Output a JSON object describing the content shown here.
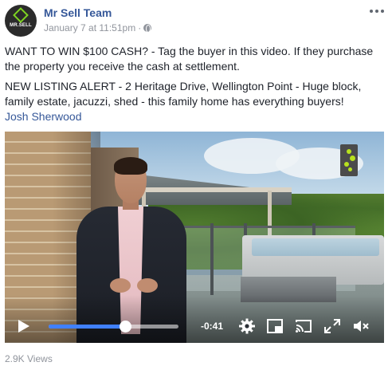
{
  "post": {
    "page_name": "Mr Sell Team",
    "avatar_text": "MR.SELL",
    "timestamp": "January 7 at 11:51pm",
    "separator": "·",
    "privacy_icon": "globe-icon",
    "options_icon": "more-options-icon",
    "text_paragraph_1": "WANT TO WIN $100 CASH? - Tag the buyer in this video. If they purchase the property you receive the cash at settlement.",
    "text_paragraph_2": "NEW LISTING ALERT - 2 Heritage Drive, Wellington Point - Huge block, family estate, jacuzzi, shed - this family home has everything buyers!",
    "tagged_person": "Josh Sherwood"
  },
  "video": {
    "time_remaining": "-0:41",
    "progress": 0.59,
    "accent_color": "#4080ff",
    "logo_color": "#b8e21e",
    "controls": {
      "play": "play-icon",
      "settings": "gear-icon",
      "pip": "picture-in-picture-icon",
      "cast": "cast-icon",
      "fullscreen": "fullscreen-icon",
      "volume": "volume-muted-icon"
    }
  },
  "footer": {
    "views": "2.9K Views"
  },
  "colors": {
    "link": "#365899",
    "meta": "#90949c",
    "text": "#1d2129"
  }
}
